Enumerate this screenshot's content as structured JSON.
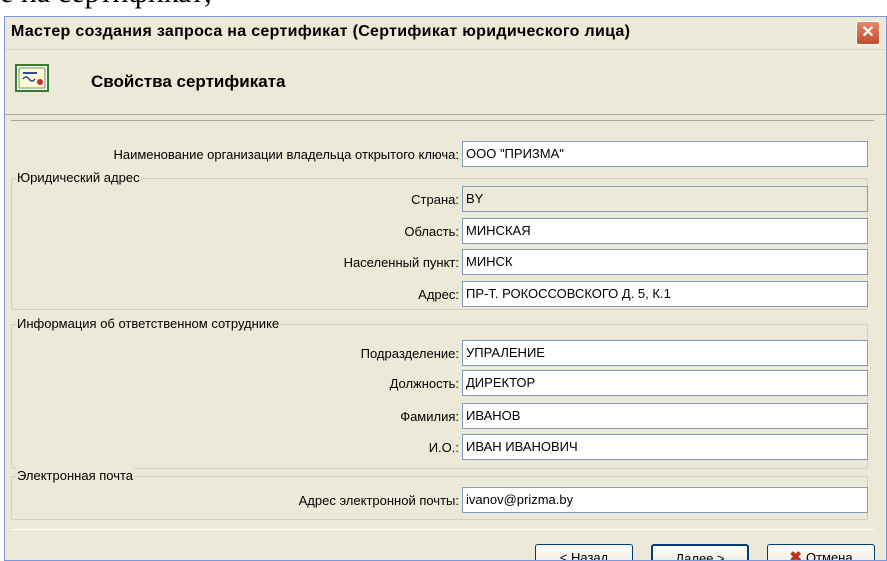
{
  "background_text": "е на сертификат;",
  "window": {
    "title": "Мастер создания запроса на сертификат (Сертификат юридического лица)",
    "close_glyph": "✕"
  },
  "header": {
    "title": "Свойства сертификата",
    "icon": "certificate-icon"
  },
  "organization": {
    "label": "Наименование организации владельца открытого ключа:",
    "value": "ООО \"ПРИЗМА\""
  },
  "legal_address": {
    "group_label": "Юридический адрес",
    "country": {
      "label": "Страна:",
      "value": "BY"
    },
    "region": {
      "label": "Область:",
      "value": "МИНСКАЯ"
    },
    "locality": {
      "label": "Населенный пункт:",
      "value": "МИНСК"
    },
    "address": {
      "label": "Адрес:",
      "value": "ПР-Т. РОКОССОВСКОГО Д. 5, К.1"
    }
  },
  "employee": {
    "group_label": "Информация об ответственном сотруднике",
    "department": {
      "label": "Подразделение:",
      "value": "УПРАЛЕНИЕ"
    },
    "position": {
      "label": "Должность:",
      "value": "ДИРЕКТОР"
    },
    "surname": {
      "label": "Фамилия:",
      "value": "ИВАНОВ"
    },
    "initials": {
      "label": "И.О.:",
      "value": "ИВАН ИВАНОВИЧ"
    }
  },
  "email": {
    "group_label": "Электронная почта",
    "address": {
      "label": "Адрес электронной почты:",
      "value": "ivanov@prizma.by"
    }
  },
  "buttons": {
    "back": "< Назад",
    "next": "Далее >",
    "cancel": "Отмена",
    "cancel_icon": "cancel-x-icon"
  }
}
